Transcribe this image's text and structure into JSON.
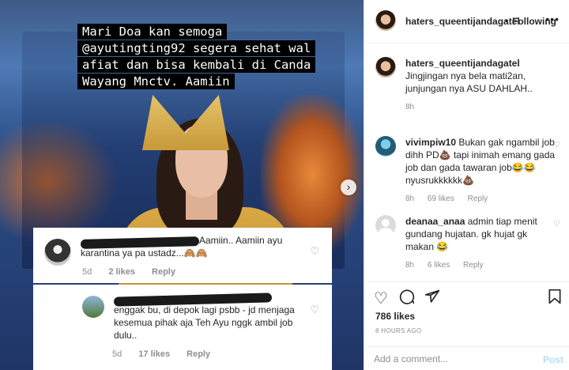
{
  "post": {
    "caption_lines": [
      "Mari Doa kan semoga",
      "@ayutingting92 segera sehat wal",
      "afiat dan bisa kembali di Canda",
      "Wayang Mnctv. Aamiin"
    ],
    "screenshot_comments": [
      {
        "text": "Aamiin.. Aamiin ayu karantina ya pa ustadz...🙈🙈",
        "age": "5d",
        "likes": "2 likes",
        "reply": "Reply"
      },
      {
        "text": "enggak bu, di depok lagi psbb - jd menjaga kesemua pihak aja Teh Ayu nggk ambil job dulu..",
        "age": "5d",
        "likes": "17 likes",
        "reply": "Reply"
      }
    ]
  },
  "header": {
    "username": "haters_queentijandagatel",
    "separator": "•",
    "follow_label": "Following",
    "more_icon": "more-horizontal-icon"
  },
  "comments": [
    {
      "username": "haters_queentijandagatel",
      "text": "Jingjingan nya bela mati2an, junjungan nya ASU DAHLAH..",
      "age": "8h",
      "likes": "",
      "reply": ""
    },
    {
      "username": "vivimpiw10",
      "text": "Bukan gak ngambil job dihh PD💩 tapi inimah emang gada job dan gada tawaran job😂😂nyusrukkkkkk💩",
      "age": "8h",
      "likes": "69 likes",
      "reply": "Reply"
    },
    {
      "username": "deanaa_anaa",
      "text": "admin tiap menit gundang hujatan. gk hujat gk makan 😂",
      "age": "8h",
      "likes": "6 likes",
      "reply": "Reply"
    }
  ],
  "actions": {
    "likes": "786 likes",
    "time_ago": "8 HOURS AGO",
    "add_comment_placeholder": "Add a comment...",
    "post_label": "Post"
  }
}
